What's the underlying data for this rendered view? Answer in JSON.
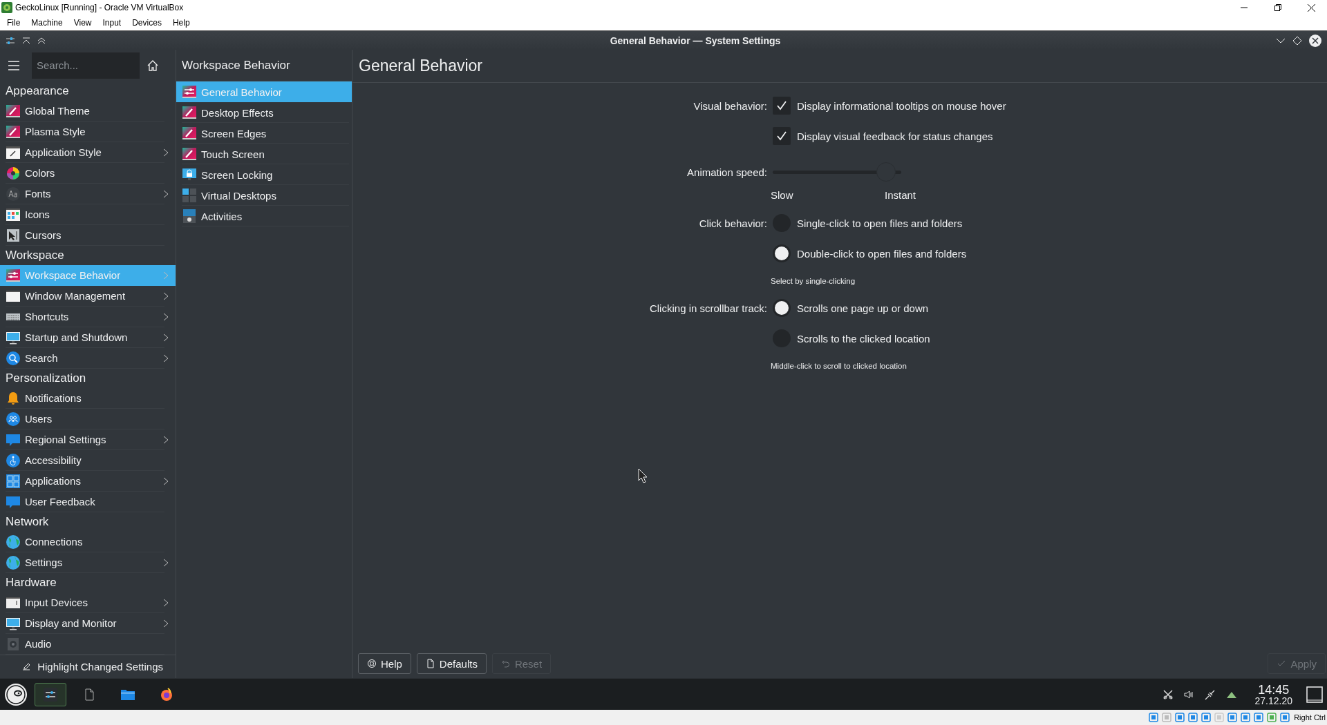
{
  "host_window": {
    "title": "GeckoLinux [Running] - Oracle VM VirtualBox",
    "menu": [
      "File",
      "Machine",
      "View",
      "Input",
      "Devices",
      "Help"
    ],
    "host_key": "Right Ctrl"
  },
  "window": {
    "title": "General Behavior — System Settings"
  },
  "sidebar": {
    "search": {
      "placeholder": "Search..."
    },
    "sections": [
      {
        "title": "Appearance",
        "items": [
          {
            "label": "Global Theme",
            "has_children": false,
            "selected": false
          },
          {
            "label": "Plasma Style",
            "has_children": false,
            "selected": false
          },
          {
            "label": "Application Style",
            "has_children": true,
            "selected": false
          },
          {
            "label": "Colors",
            "has_children": false,
            "selected": false
          },
          {
            "label": "Fonts",
            "has_children": true,
            "selected": false
          },
          {
            "label": "Icons",
            "has_children": false,
            "selected": false
          },
          {
            "label": "Cursors",
            "has_children": false,
            "selected": false
          }
        ]
      },
      {
        "title": "Workspace",
        "items": [
          {
            "label": "Workspace Behavior",
            "has_children": true,
            "selected": true
          },
          {
            "label": "Window Management",
            "has_children": true,
            "selected": false
          },
          {
            "label": "Shortcuts",
            "has_children": true,
            "selected": false
          },
          {
            "label": "Startup and Shutdown",
            "has_children": true,
            "selected": false
          },
          {
            "label": "Search",
            "has_children": true,
            "selected": false
          }
        ]
      },
      {
        "title": "Personalization",
        "items": [
          {
            "label": "Notifications",
            "has_children": false,
            "selected": false
          },
          {
            "label": "Users",
            "has_children": false,
            "selected": false
          },
          {
            "label": "Regional Settings",
            "has_children": true,
            "selected": false
          },
          {
            "label": "Accessibility",
            "has_children": false,
            "selected": false
          },
          {
            "label": "Applications",
            "has_children": true,
            "selected": false
          },
          {
            "label": "User Feedback",
            "has_children": false,
            "selected": false
          }
        ]
      },
      {
        "title": "Network",
        "items": [
          {
            "label": "Connections",
            "has_children": false,
            "selected": false
          },
          {
            "label": "Settings",
            "has_children": true,
            "selected": false
          }
        ]
      },
      {
        "title": "Hardware",
        "items": [
          {
            "label": "Input Devices",
            "has_children": true,
            "selected": false
          },
          {
            "label": "Display and Monitor",
            "has_children": true,
            "selected": false
          },
          {
            "label": "Audio",
            "has_children": false,
            "selected": false
          }
        ]
      }
    ],
    "footer": "Highlight Changed Settings"
  },
  "subpanel": {
    "title": "Workspace Behavior",
    "items": [
      {
        "label": "General Behavior",
        "selected": true
      },
      {
        "label": "Desktop Effects",
        "selected": false
      },
      {
        "label": "Screen Edges",
        "selected": false
      },
      {
        "label": "Touch Screen",
        "selected": false
      },
      {
        "label": "Screen Locking",
        "selected": false
      },
      {
        "label": "Virtual Desktops",
        "selected": false
      },
      {
        "label": "Activities",
        "selected": false
      }
    ]
  },
  "page": {
    "title": "General Behavior",
    "rows": [
      {
        "kind": "checkbox",
        "label": "Visual behavior:",
        "text": "Display informational tooltips on mouse hover",
        "checked": true
      },
      {
        "kind": "checkbox",
        "text": "Display visual feedback for status changes",
        "checked": true
      },
      {
        "kind": "slider",
        "label": "Animation speed:",
        "level": 0.95,
        "min_label": "Slow",
        "max_label": "Instant"
      },
      {
        "kind": "radio",
        "label": "Click behavior:",
        "text": "Single-click to open files and folders",
        "selected": false
      },
      {
        "kind": "radio",
        "text": "Double-click to open files and folders",
        "selected": true
      },
      {
        "kind": "hint",
        "text": "Select by single-clicking"
      },
      {
        "kind": "radio",
        "label": "Clicking in scrollbar track:",
        "text": "Scrolls one page up or down",
        "selected": true
      },
      {
        "kind": "radio",
        "text": "Scrolls to the clicked location",
        "selected": false
      },
      {
        "kind": "hint",
        "text": "Middle-click to scroll to clicked location"
      }
    ],
    "buttons": [
      {
        "label": "Help",
        "disabled": false
      },
      {
        "label": "Defaults",
        "disabled": false
      },
      {
        "label": "Reset",
        "disabled": true
      }
    ],
    "apply": {
      "label": "Apply",
      "disabled": true
    }
  },
  "taskbar": {
    "tasks": [
      {
        "selected": true
      },
      {
        "selected": false
      },
      {
        "selected": false
      },
      {
        "selected": false
      }
    ],
    "time": "14:45",
    "date": "27.12.20"
  }
}
